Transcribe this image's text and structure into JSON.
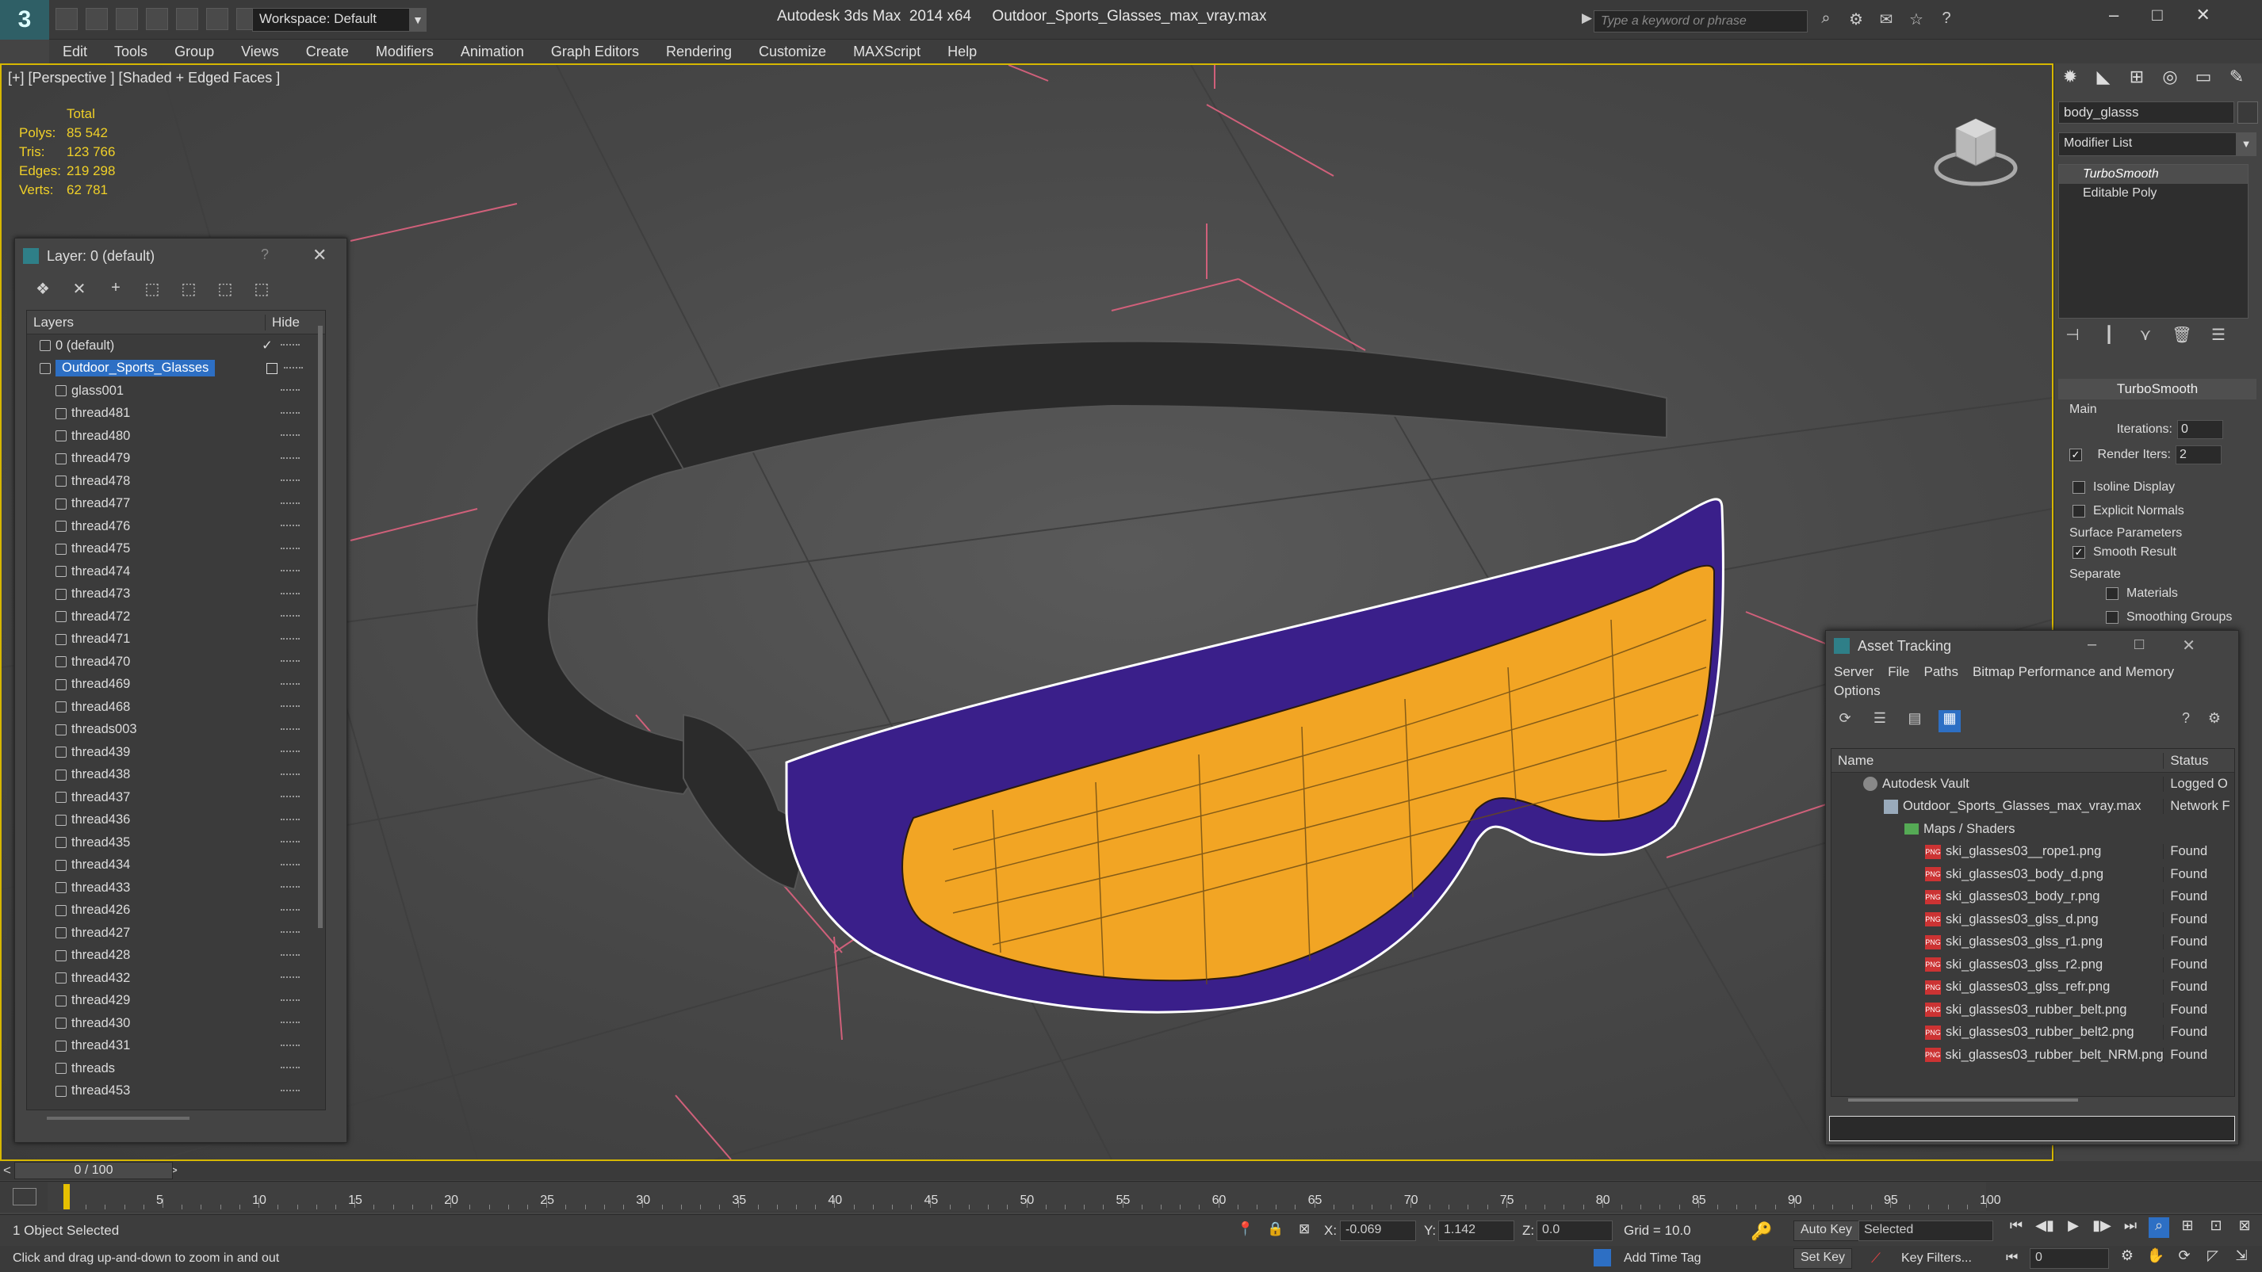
{
  "title_bar": {
    "app_title": "Autodesk 3ds Max  2014 x64     Outdoor_Sports_Glasses_max_vray.max",
    "workspace": "Workspace: Default",
    "search_placeholder": "Type a keyword or phrase"
  },
  "menu": [
    "Edit",
    "Tools",
    "Group",
    "Views",
    "Create",
    "Modifiers",
    "Animation",
    "Graph Editors",
    "Rendering",
    "Customize",
    "MAXScript",
    "Help"
  ],
  "viewport": {
    "label": "[+] [Perspective ] [Shaded + Edged Faces ]",
    "stats": {
      "header": "Total",
      "rows": [
        {
          "k": "Polys:",
          "v": "85 542"
        },
        {
          "k": "Tris:",
          "v": "123 766"
        },
        {
          "k": "Edges:",
          "v": "219 298"
        },
        {
          "k": "Verts:",
          "v": "62 781"
        }
      ]
    }
  },
  "layer_panel": {
    "title": "Layer: 0 (default)",
    "help": "?",
    "col_layers": "Layers",
    "col_hide": "Hide",
    "rows": [
      {
        "name": "0 (default)",
        "level": 0,
        "kind": "layer",
        "current": true
      },
      {
        "name": "Outdoor_Sports_Glasses",
        "level": 0,
        "kind": "layer",
        "selected": true
      },
      {
        "name": "glass001",
        "level": 1,
        "kind": "object"
      },
      {
        "name": "thread481",
        "level": 1,
        "kind": "object"
      },
      {
        "name": "thread480",
        "level": 1,
        "kind": "object"
      },
      {
        "name": "thread479",
        "level": 1,
        "kind": "object"
      },
      {
        "name": "thread478",
        "level": 1,
        "kind": "object"
      },
      {
        "name": "thread477",
        "level": 1,
        "kind": "object"
      },
      {
        "name": "thread476",
        "level": 1,
        "kind": "object"
      },
      {
        "name": "thread475",
        "level": 1,
        "kind": "object"
      },
      {
        "name": "thread474",
        "level": 1,
        "kind": "object"
      },
      {
        "name": "thread473",
        "level": 1,
        "kind": "object"
      },
      {
        "name": "thread472",
        "level": 1,
        "kind": "object"
      },
      {
        "name": "thread471",
        "level": 1,
        "kind": "object"
      },
      {
        "name": "thread470",
        "level": 1,
        "kind": "object"
      },
      {
        "name": "thread469",
        "level": 1,
        "kind": "object"
      },
      {
        "name": "thread468",
        "level": 1,
        "kind": "object"
      },
      {
        "name": "threads003",
        "level": 1,
        "kind": "object"
      },
      {
        "name": "thread439",
        "level": 1,
        "kind": "object"
      },
      {
        "name": "thread438",
        "level": 1,
        "kind": "object"
      },
      {
        "name": "thread437",
        "level": 1,
        "kind": "object"
      },
      {
        "name": "thread436",
        "level": 1,
        "kind": "object"
      },
      {
        "name": "thread435",
        "level": 1,
        "kind": "object"
      },
      {
        "name": "thread434",
        "level": 1,
        "kind": "object"
      },
      {
        "name": "thread433",
        "level": 1,
        "kind": "object"
      },
      {
        "name": "thread426",
        "level": 1,
        "kind": "object"
      },
      {
        "name": "thread427",
        "level": 1,
        "kind": "object"
      },
      {
        "name": "thread428",
        "level": 1,
        "kind": "object"
      },
      {
        "name": "thread432",
        "level": 1,
        "kind": "object"
      },
      {
        "name": "thread429",
        "level": 1,
        "kind": "object"
      },
      {
        "name": "thread430",
        "level": 1,
        "kind": "object"
      },
      {
        "name": "thread431",
        "level": 1,
        "kind": "object"
      },
      {
        "name": "threads",
        "level": 1,
        "kind": "object"
      },
      {
        "name": "thread453",
        "level": 1,
        "kind": "object"
      }
    ]
  },
  "command_panel": {
    "object_name": "body_glasss",
    "modifier_list": "Modifier List",
    "stack": [
      "TurboSmooth",
      "Editable Poly"
    ],
    "turbosmooth": {
      "header": "TurboSmooth",
      "main": "Main",
      "iterations_label": "Iterations:",
      "iterations": "0",
      "render_iters_label": "Render Iters:",
      "render_iters": "2",
      "isoline": "Isoline Display",
      "explicit_normals": "Explicit Normals",
      "surface_params": "Surface Parameters",
      "smooth_result": "Smooth Result",
      "separate": "Separate",
      "materials": "Materials",
      "smoothing_groups": "Smoothing Groups"
    }
  },
  "asset_tracking": {
    "title": "Asset Tracking",
    "menu": [
      "Server",
      "File",
      "Paths",
      "Bitmap Performance and Memory"
    ],
    "menu2": "Options",
    "col_name": "Name",
    "col_status": "Status",
    "rows": [
      {
        "name": "Autodesk Vault",
        "status": "Logged O",
        "level": 0,
        "kind": "vault"
      },
      {
        "name": "Outdoor_Sports_Glasses_max_vray.max",
        "status": "Network F",
        "level": 1,
        "kind": "file"
      },
      {
        "name": "Maps / Shaders",
        "status": "",
        "level": 2,
        "kind": "folder"
      },
      {
        "name": "ski_glasses03__rope1.png",
        "status": "Found",
        "level": 3,
        "kind": "png"
      },
      {
        "name": "ski_glasses03_body_d.png",
        "status": "Found",
        "level": 3,
        "kind": "png"
      },
      {
        "name": "ski_glasses03_body_r.png",
        "status": "Found",
        "level": 3,
        "kind": "png"
      },
      {
        "name": "ski_glasses03_glss_d.png",
        "status": "Found",
        "level": 3,
        "kind": "png"
      },
      {
        "name": "ski_glasses03_glss_r1.png",
        "status": "Found",
        "level": 3,
        "kind": "png"
      },
      {
        "name": "ski_glasses03_glss_r2.png",
        "status": "Found",
        "level": 3,
        "kind": "png"
      },
      {
        "name": "ski_glasses03_glss_refr.png",
        "status": "Found",
        "level": 3,
        "kind": "png"
      },
      {
        "name": "ski_glasses03_rubber_belt.png",
        "status": "Found",
        "level": 3,
        "kind": "png"
      },
      {
        "name": "ski_glasses03_rubber_belt2.png",
        "status": "Found",
        "level": 3,
        "kind": "png"
      },
      {
        "name": "ski_glasses03_rubber_belt_NRM.png",
        "status": "Found",
        "level": 3,
        "kind": "png"
      }
    ]
  },
  "timeline": {
    "frame_display": "0 / 100",
    "ticks": [
      0,
      5,
      10,
      15,
      20,
      25,
      30,
      35,
      40,
      45,
      50,
      55,
      60,
      65,
      70,
      75,
      80,
      85,
      90,
      95,
      100
    ],
    "labels": [
      "5",
      "10",
      "15",
      "20",
      "25",
      "30",
      "35",
      "40",
      "45",
      "50",
      "55",
      "60",
      "65",
      "70",
      "75",
      "80",
      "85",
      "90",
      "95",
      "100"
    ]
  },
  "status": {
    "selection": "1 Object Selected",
    "prompt": "Click and drag up-and-down to zoom in and out",
    "x_label": "X:",
    "x": "-0.069",
    "y_label": "Y:",
    "y": "1.142",
    "z_label": "Z:",
    "z": "0.0",
    "grid": "Grid = 10.0",
    "add_time_tag": "Add Time Tag",
    "auto_key": "Auto Key",
    "set_key": "Set Key",
    "selected": "Selected",
    "key_filters": "Key Filters...",
    "frame": "0"
  },
  "colors": {
    "accent": "#d6b700",
    "selection": "#2d6fc4",
    "lens": "#f2a524",
    "frame": "#3a1f8a",
    "stats": "#f0d028"
  }
}
